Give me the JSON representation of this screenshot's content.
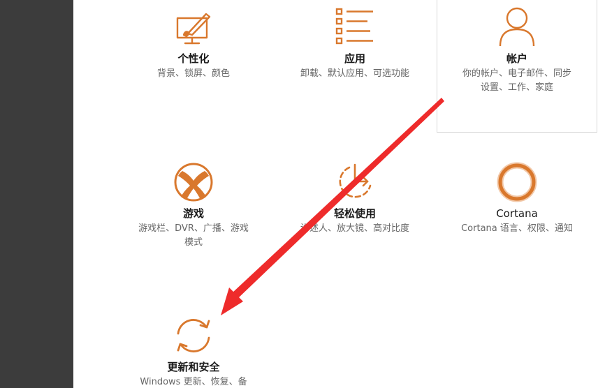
{
  "accent_color": "#d9782d",
  "annotation_color": "#ee2b2b",
  "tiles": [
    {
      "id": "personalization",
      "icon": "personalization-icon",
      "title": "个性化",
      "desc": [
        "背景、锁屏、颜色"
      ]
    },
    {
      "id": "apps",
      "icon": "apps-list-icon",
      "title": "应用",
      "desc": [
        "卸载、默认应用、可选功能"
      ]
    },
    {
      "id": "accounts",
      "icon": "person-icon",
      "title": "帐户",
      "desc": [
        "你的帐户、电子邮件、同步",
        "设置、工作、家庭"
      ]
    },
    {
      "id": "gaming",
      "icon": "xbox-icon",
      "title": "游戏",
      "desc": [
        "游戏栏、DVR、广播、游戏",
        "模式"
      ]
    },
    {
      "id": "ease-of-access",
      "icon": "ease-of-access-icon",
      "title": "轻松使用",
      "desc": [
        "讲述人、放大镜、高对比度"
      ]
    },
    {
      "id": "cortana",
      "icon": "cortana-ring-icon",
      "title": "Cortana",
      "desc": [
        "Cortana 语言、权限、通知"
      ]
    },
    {
      "id": "update-security",
      "icon": "update-sync-icon",
      "title": "更新和安全",
      "desc": [
        "Windows 更新、恢复、备"
      ]
    }
  ]
}
